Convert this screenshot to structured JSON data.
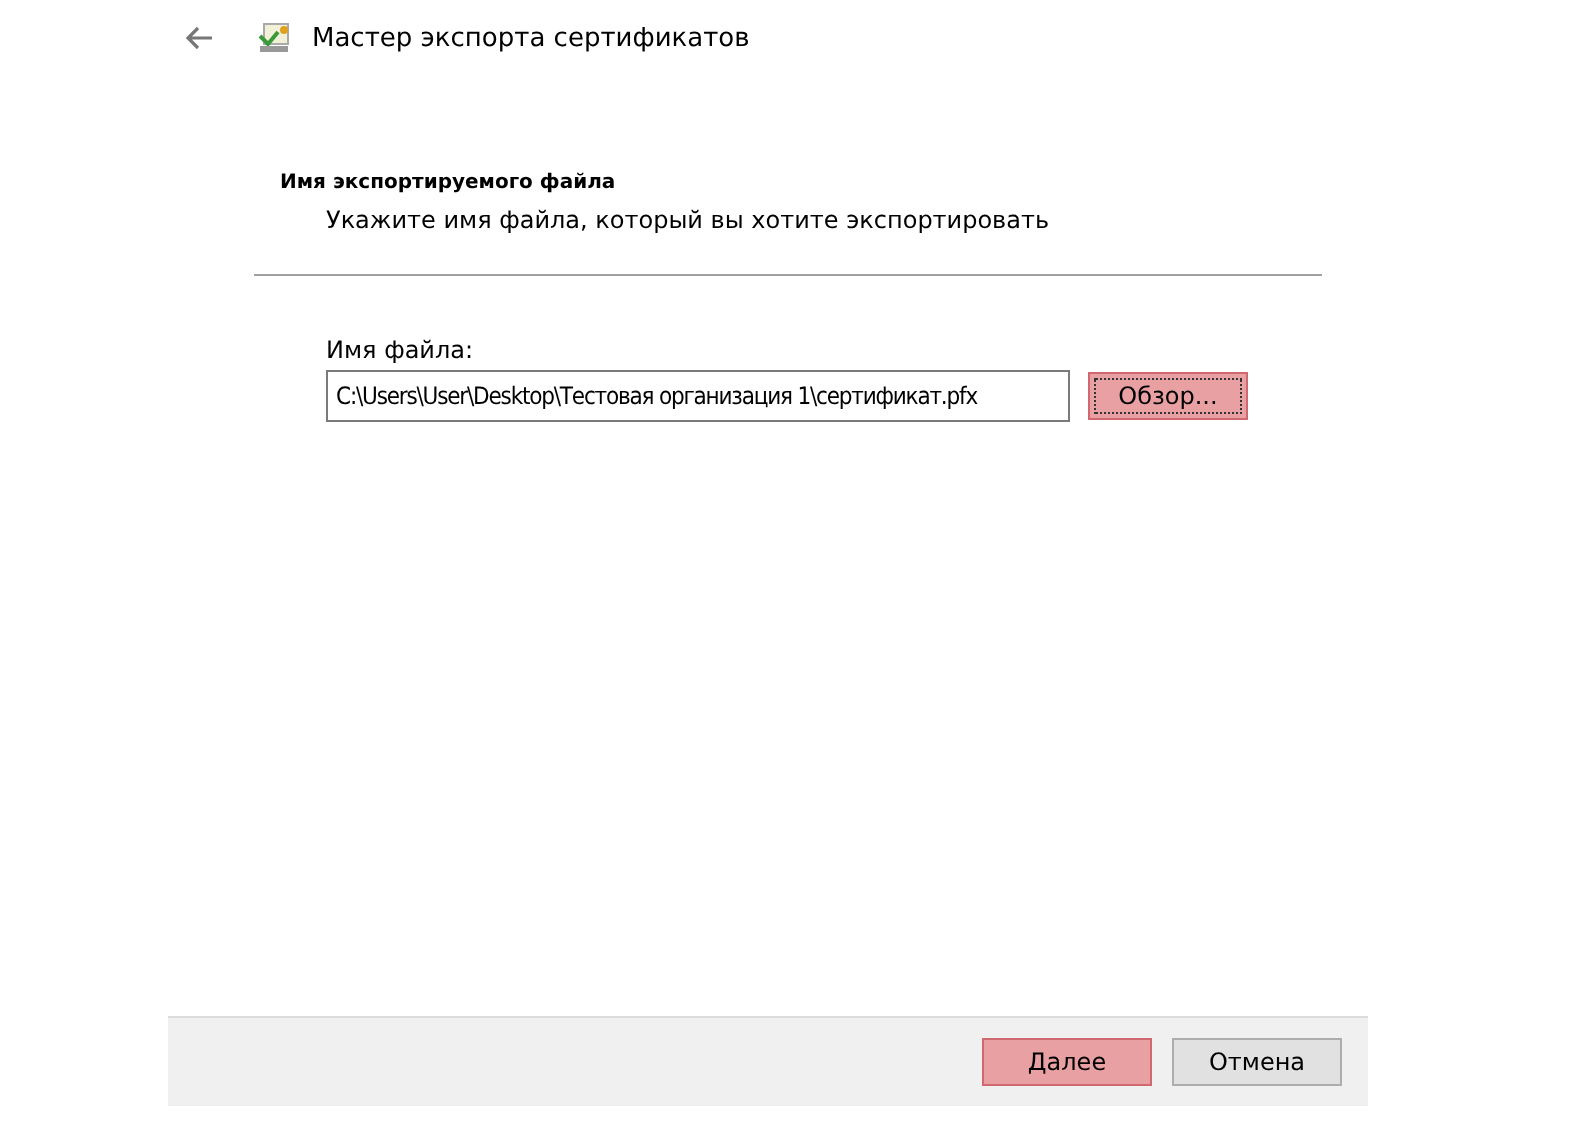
{
  "window": {
    "title": "Мастер экспорта сертификатов"
  },
  "page": {
    "heading": "Имя экспортируемого файла",
    "subheading": "Укажите имя файла, который вы хотите экспортировать"
  },
  "file_field": {
    "label": "Имя файла:",
    "value": "C:\\Users\\User\\Desktop\\Тестовая организация 1\\сертификат.pfx",
    "browse_button": {
      "label": "Обзор...",
      "highlighted": true,
      "focused": true
    }
  },
  "buttons": [
    {
      "label": "Далее",
      "highlighted": true
    },
    {
      "label": "Отмена",
      "highlighted": false
    }
  ]
}
